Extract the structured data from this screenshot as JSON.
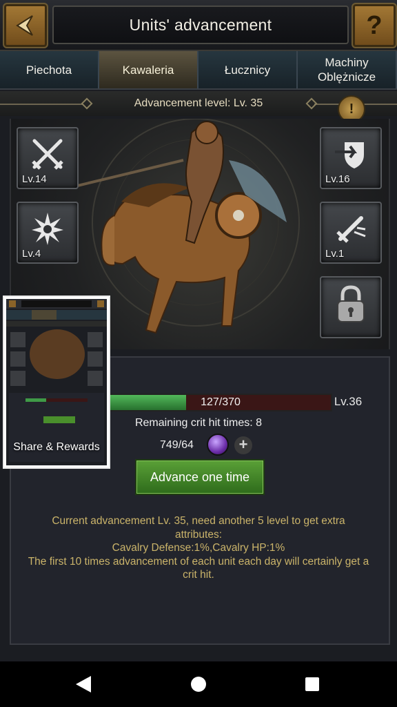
{
  "header": {
    "title": "Units' advancement",
    "help_symbol": "?"
  },
  "tabs": [
    {
      "label": "Piechota"
    },
    {
      "label": "Kawaleria"
    },
    {
      "label": "Łucznicy"
    },
    {
      "label": "Machiny\nOblężnicze"
    }
  ],
  "advancement": {
    "level_text": "Advancement level: Lv. 35",
    "info_symbol": "!"
  },
  "skills": {
    "left": [
      {
        "level": "Lv.14",
        "icon": "crossed-swords-icon"
      },
      {
        "level": "Lv.4",
        "icon": "burst-icon"
      }
    ],
    "right": [
      {
        "level": "Lv.16",
        "icon": "shield-arrow-icon"
      },
      {
        "level": "Lv.1",
        "icon": "broken-sword-icon"
      },
      {
        "level": "",
        "icon": "padlock-icon"
      }
    ]
  },
  "progress": {
    "current": 127,
    "max": 370,
    "text": "127/370",
    "next_level": "Lv.36"
  },
  "crit": {
    "text": "Remaining crit hit times: 8"
  },
  "resource": {
    "amount": "749/64",
    "icon": "purple-gem-icon",
    "add_symbol": "+"
  },
  "advance_button": {
    "label": "Advance one time"
  },
  "description": {
    "line1": "Current advancement Lv. 35, need another 5 level to get extra attributes:",
    "line2": "Cavalry Defense:1%,Cavalry HP:1%",
    "line3": "The first 10 times advancement of each unit each day will certainly get a crit hit."
  },
  "share": {
    "label": "Share & Rewards"
  },
  "colors": {
    "accent_gold": "#cbb46a",
    "button_green": "#4a8f2c",
    "progress_green": "#3f9a47",
    "background": "#1b1d22"
  }
}
